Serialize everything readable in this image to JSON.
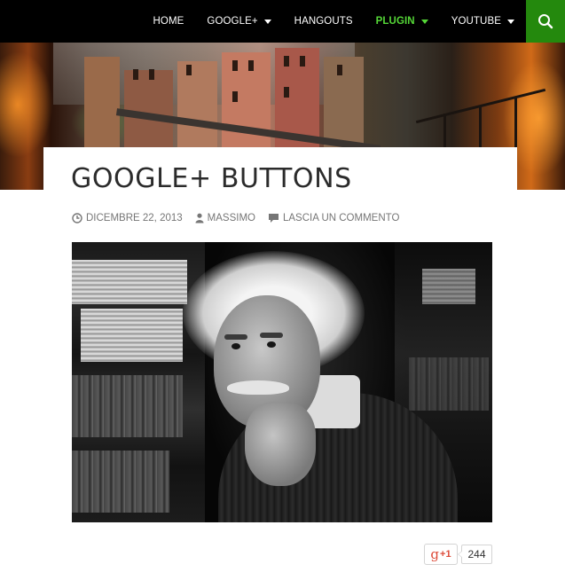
{
  "nav": {
    "items": [
      {
        "label": "HOME",
        "has_dropdown": false,
        "active": false
      },
      {
        "label": "GOOGLE+",
        "has_dropdown": true,
        "active": false
      },
      {
        "label": "HANGOUTS",
        "has_dropdown": false,
        "active": false
      },
      {
        "label": "PLUGIN",
        "has_dropdown": true,
        "active": true
      },
      {
        "label": "YOUTUBE",
        "has_dropdown": true,
        "active": false
      }
    ],
    "search_icon": "search-icon",
    "active_color": "#55d737",
    "search_bg": "#24890d"
  },
  "post": {
    "title": "GOOGLE+ BUTTONS",
    "meta": {
      "date": "DICEMBRE 22, 2013",
      "author": "MASSIMO",
      "comments": "LASCIA UN COMMENTO"
    }
  },
  "share": {
    "plus_one_label": "+1",
    "count": "244"
  }
}
